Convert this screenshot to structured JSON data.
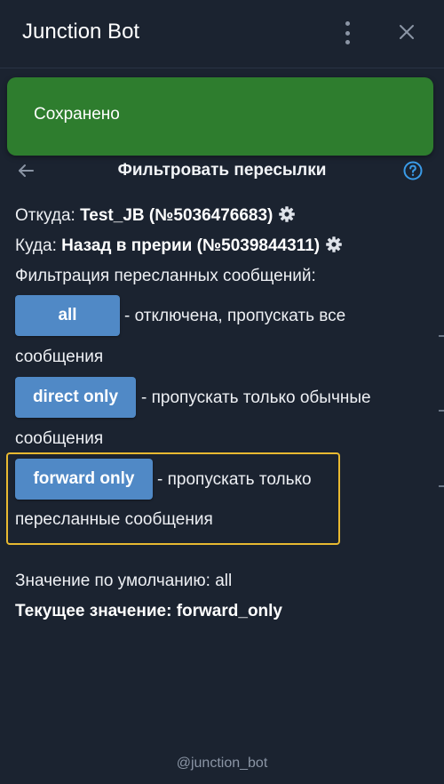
{
  "header": {
    "title": "Junction Bot",
    "menu_icon": "kebab-menu-icon",
    "close_icon": "close-icon"
  },
  "toast": {
    "text": "Сохранено",
    "color": "#2e7d2e"
  },
  "panel": {
    "title": "Фильтровать пересылки",
    "back_icon": "arrow-left-icon",
    "help_icon": "question-circle-icon",
    "from_label": "Откуда:",
    "from_value": "Test_JB (№5036476683)",
    "to_label": "Куда:",
    "to_value": "Назад в прерии (№5039844311)",
    "filter_label": "Фильтрация пересланных сообщений:",
    "options": [
      {
        "button": "all",
        "desc_line1": "- отключена, пропускать все",
        "desc_line2": "сообщения"
      },
      {
        "button": "direct only",
        "desc_line1": "- пропускать только обычные",
        "desc_line2": "сообщения"
      },
      {
        "button": "forward only",
        "desc_line1": "- пропускать только",
        "desc_line2": "пересланные сообщения",
        "highlighted": true
      }
    ],
    "default_label": "Значение по умолчанию: all",
    "current_label": "Текущее значение:",
    "current_value": "forward_only"
  },
  "footer": {
    "text": "@junction_bot"
  },
  "colors": {
    "background": "#1b2330",
    "button": "#5089c6",
    "highlight": "#e8b931",
    "accent": "#3a9be8"
  }
}
